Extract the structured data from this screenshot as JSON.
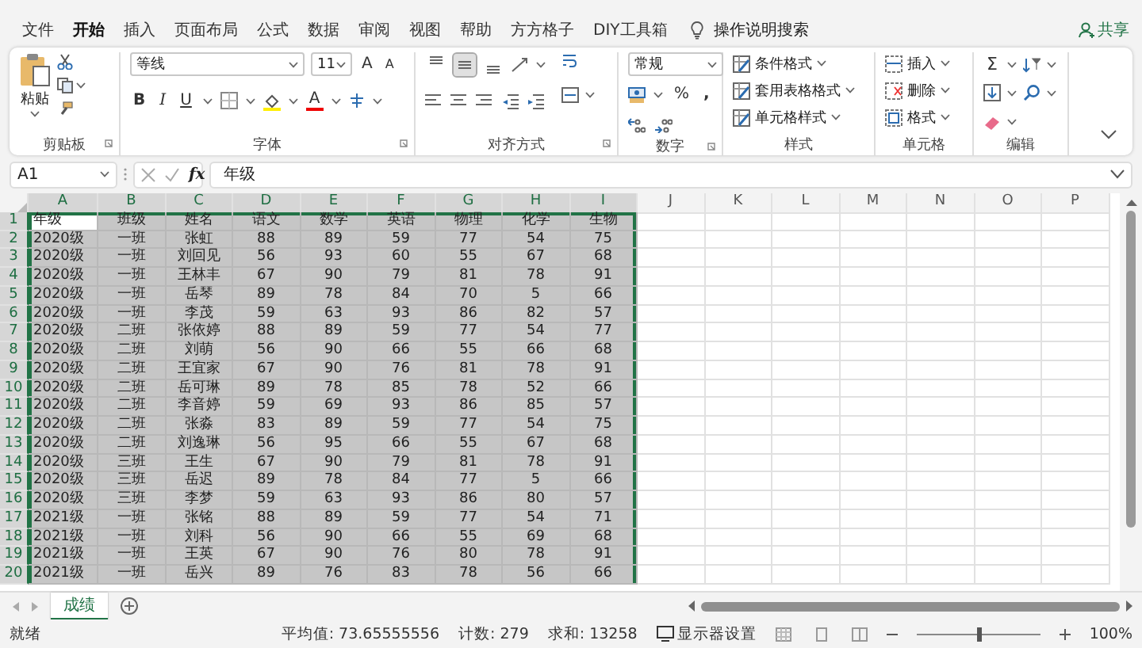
{
  "menu": [
    {
      "label": "文件",
      "selected": false
    },
    {
      "label": "开始",
      "selected": true
    },
    {
      "label": "插入",
      "selected": false
    },
    {
      "label": "页面布局",
      "selected": false
    },
    {
      "label": "公式",
      "selected": false
    },
    {
      "label": "数据",
      "selected": false
    },
    {
      "label": "审阅",
      "selected": false
    },
    {
      "label": "视图",
      "selected": false
    },
    {
      "label": "帮助",
      "selected": false
    },
    {
      "label": "方方格子",
      "selected": false
    },
    {
      "label": "DIY工具箱",
      "selected": false
    }
  ],
  "tell_me": "操作说明搜索",
  "share": "共享",
  "ribbon": {
    "clipboard": {
      "paste": "粘贴",
      "label": "剪贴板"
    },
    "font": {
      "name": "等线",
      "size": "11",
      "grow": "A",
      "shrink": "A",
      "bold": "B",
      "italic": "I",
      "underline": "U",
      "font_color": "A",
      "label": "字体"
    },
    "alignment": {
      "vertical": [
        {
          "selected": false
        },
        {
          "selected": true
        },
        {
          "selected": false
        }
      ],
      "label": "对齐方式"
    },
    "number": {
      "format": "常规",
      "percent": "%",
      "comma": ",",
      "label": "数字"
    },
    "styles": {
      "items": [
        "条件格式",
        "套用表格格式",
        "单元格样式"
      ],
      "label": "样式"
    },
    "cells": {
      "items": [
        "插入",
        "删除",
        "格式"
      ],
      "label": "单元格"
    },
    "editing": {
      "sum": "Σ",
      "label": "编辑"
    }
  },
  "formula_bar": {
    "name_box": "A1",
    "fx": "fx",
    "formula": "年级"
  },
  "sheet": {
    "columns": [
      {
        "label": "A",
        "selected": true,
        "active": true
      },
      {
        "label": "B",
        "selected": true,
        "active": false
      },
      {
        "label": "C",
        "selected": true,
        "active": false
      },
      {
        "label": "D",
        "selected": true,
        "active": false
      },
      {
        "label": "E",
        "selected": true,
        "active": false
      },
      {
        "label": "F",
        "selected": true,
        "active": false
      },
      {
        "label": "G",
        "selected": true,
        "active": false
      },
      {
        "label": "H",
        "selected": true,
        "active": false
      },
      {
        "label": "I",
        "selected": true,
        "active": false
      },
      {
        "label": "J",
        "selected": false,
        "active": false
      },
      {
        "label": "K",
        "selected": false,
        "active": false
      },
      {
        "label": "L",
        "selected": false,
        "active": false
      },
      {
        "label": "M",
        "selected": false,
        "active": false
      },
      {
        "label": "N",
        "selected": false,
        "active": false
      },
      {
        "label": "O",
        "selected": false,
        "active": false
      },
      {
        "label": "P",
        "selected": false,
        "active": false
      }
    ],
    "rows": [
      {
        "number": "1",
        "selected": true,
        "active": true,
        "cells": [
          "年级",
          "班级",
          "姓名",
          "语文",
          "数学",
          "英语",
          "物理",
          "化学",
          "生物"
        ]
      },
      {
        "number": "2",
        "selected": true,
        "active": false,
        "cells": [
          "2020级",
          "一班",
          "张虹",
          "88",
          "89",
          "59",
          "77",
          "54",
          "75"
        ]
      },
      {
        "number": "3",
        "selected": true,
        "active": false,
        "cells": [
          "2020级",
          "一班",
          "刘回见",
          "56",
          "93",
          "60",
          "55",
          "67",
          "68"
        ]
      },
      {
        "number": "4",
        "selected": true,
        "active": false,
        "cells": [
          "2020级",
          "一班",
          "王林丰",
          "67",
          "90",
          "79",
          "81",
          "78",
          "91"
        ]
      },
      {
        "number": "5",
        "selected": true,
        "active": false,
        "cells": [
          "2020级",
          "一班",
          "岳琴",
          "89",
          "78",
          "84",
          "70",
          "5",
          "66"
        ]
      },
      {
        "number": "6",
        "selected": true,
        "active": false,
        "cells": [
          "2020级",
          "一班",
          "李茂",
          "59",
          "63",
          "93",
          "86",
          "82",
          "57"
        ]
      },
      {
        "number": "7",
        "selected": true,
        "active": false,
        "cells": [
          "2020级",
          "二班",
          "张依婷",
          "88",
          "89",
          "59",
          "77",
          "54",
          "77"
        ]
      },
      {
        "number": "8",
        "selected": true,
        "active": false,
        "cells": [
          "2020级",
          "二班",
          "刘萌",
          "56",
          "90",
          "66",
          "55",
          "66",
          "68"
        ]
      },
      {
        "number": "9",
        "selected": true,
        "active": false,
        "cells": [
          "2020级",
          "二班",
          "王宜家",
          "67",
          "90",
          "76",
          "81",
          "78",
          "91"
        ]
      },
      {
        "number": "10",
        "selected": true,
        "active": false,
        "cells": [
          "2020级",
          "二班",
          "岳可琳",
          "89",
          "78",
          "85",
          "78",
          "52",
          "66"
        ]
      },
      {
        "number": "11",
        "selected": true,
        "active": false,
        "cells": [
          "2020级",
          "二班",
          "李音婷",
          "59",
          "69",
          "93",
          "86",
          "85",
          "57"
        ]
      },
      {
        "number": "12",
        "selected": true,
        "active": false,
        "cells": [
          "2020级",
          "二班",
          "张淼",
          "83",
          "89",
          "59",
          "77",
          "54",
          "75"
        ]
      },
      {
        "number": "13",
        "selected": true,
        "active": false,
        "cells": [
          "2020级",
          "二班",
          "刘逸琳",
          "56",
          "95",
          "66",
          "55",
          "67",
          "68"
        ]
      },
      {
        "number": "14",
        "selected": true,
        "active": false,
        "cells": [
          "2020级",
          "三班",
          "王生",
          "67",
          "90",
          "79",
          "81",
          "78",
          "91"
        ]
      },
      {
        "number": "15",
        "selected": true,
        "active": false,
        "cells": [
          "2020级",
          "三班",
          "岳迟",
          "89",
          "78",
          "84",
          "77",
          "5",
          "66"
        ]
      },
      {
        "number": "16",
        "selected": true,
        "active": false,
        "cells": [
          "2020级",
          "三班",
          "李梦",
          "59",
          "63",
          "93",
          "86",
          "80",
          "57"
        ]
      },
      {
        "number": "17",
        "selected": true,
        "active": false,
        "cells": [
          "2021级",
          "一班",
          "张铭",
          "88",
          "89",
          "59",
          "77",
          "54",
          "71"
        ]
      },
      {
        "number": "18",
        "selected": true,
        "active": false,
        "cells": [
          "2021级",
          "一班",
          "刘科",
          "56",
          "90",
          "66",
          "55",
          "69",
          "68"
        ]
      },
      {
        "number": "19",
        "selected": true,
        "active": false,
        "cells": [
          "2021级",
          "一班",
          "王英",
          "67",
          "90",
          "76",
          "80",
          "78",
          "91"
        ]
      },
      {
        "number": "20",
        "selected": true,
        "active": false,
        "cells": [
          "2021级",
          "一班",
          "岳兴",
          "89",
          "76",
          "83",
          "78",
          "56",
          "66"
        ]
      }
    ]
  },
  "sheet_tabs": [
    {
      "label": "成绩",
      "selected": true
    }
  ],
  "status": {
    "ready": "就绪",
    "average": "平均值: 73.65555556",
    "count": "计数: 279",
    "sum": "求和: 13258",
    "display_settings": "显示器设置",
    "zoom_slider": {
      "level": 0.5
    },
    "zoom": "100%"
  }
}
